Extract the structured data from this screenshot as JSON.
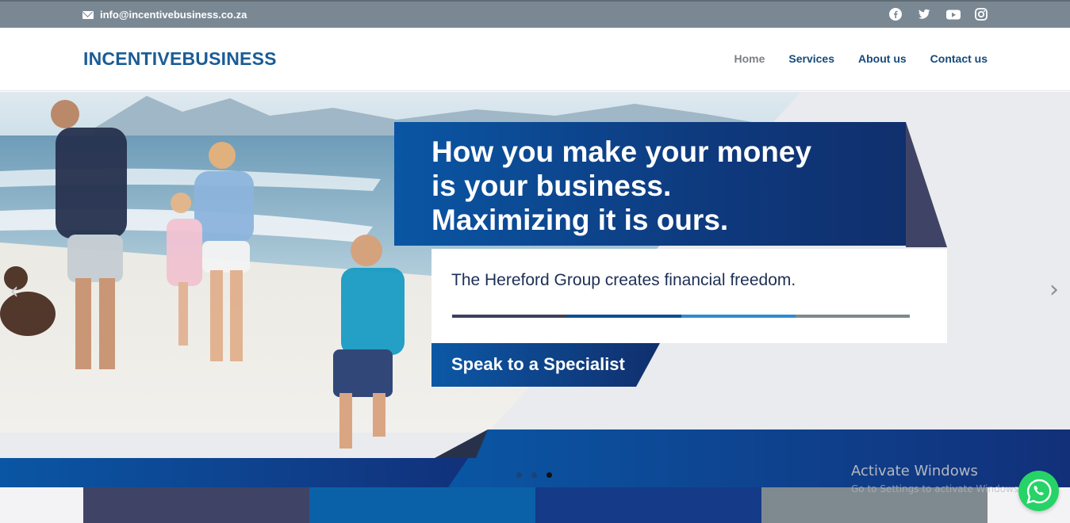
{
  "topbar": {
    "email": "info@incentivebusiness.co.za",
    "email_icon": "envelope-icon",
    "socials": [
      "facebook-icon",
      "twitter-icon",
      "youtube-icon",
      "instagram-icon"
    ]
  },
  "header": {
    "logo": "INCENTIVEBUSINESS",
    "nav": [
      {
        "label": "Home",
        "active": true
      },
      {
        "label": "Services",
        "active": false
      },
      {
        "label": "About us",
        "active": false
      },
      {
        "label": "Contact us",
        "active": false
      }
    ]
  },
  "hero": {
    "headline": "How you make your money\nis your business.\nMaximizing it is ours.",
    "subtext": "The Hereford Group creates financial freedom.",
    "cta": "Speak to a Specialist",
    "prev_arrow": "‹",
    "next_arrow": "›",
    "slides": 3,
    "active_slide": 3
  },
  "watermark": {
    "line1": "Activate Windows",
    "line2": "Go to Settings to activate Windows."
  },
  "colors": {
    "brand_blue": "#1b5c96",
    "dark_navy": "#0e3a7e",
    "topbar": "#7a8893",
    "tiles": [
      "#3f4466",
      "#0b61a8",
      "#153a87",
      "#7f8a90"
    ],
    "stripe": [
      "#3d3f5e",
      "#0c4f91",
      "#2f8bcf",
      "#7c8a8a"
    ],
    "whatsapp": "#25d366"
  }
}
